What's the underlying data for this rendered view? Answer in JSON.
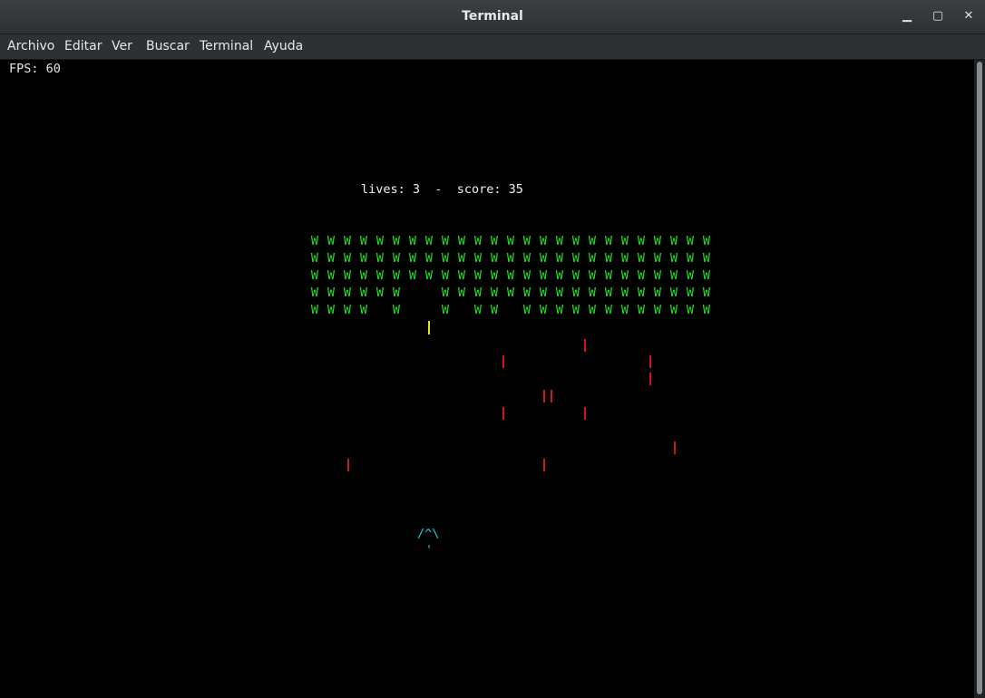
{
  "window": {
    "title": "Terminal",
    "minimize": "▁",
    "maximize": "▢",
    "close": "✕"
  },
  "menu": [
    "Archivo",
    "Editar",
    "Ver",
    "Buscar",
    "Terminal",
    "Ayuda"
  ],
  "game": {
    "fps_text": "FPS: 60",
    "lives_label": "lives:",
    "lives": "3",
    "separator": "-",
    "score_label": "score:",
    "score": "35",
    "alien_glyph": "W",
    "alien_rows": [
      "WWWWWWWWWWWWWWWWWWWWWWWWW",
      "WWWWWWWWWWWWWWWWWWWWWWWWW",
      "WWWWWWWWWWWWWWWWWWWWWWWWW",
      "WWWWWW  WWWWWWWWWWWWWWWWW",
      "WWWW W  W WW WWWWWWWWWWWW"
    ],
    "ship_top": "/^\\",
    "ship_bottom": "'",
    "colors": {
      "alien": "#22e01f",
      "enemy_bullet": "#d01616",
      "player_bullet": "#f0e011",
      "ship": "#26c5e0",
      "text": "#f0f0f0"
    }
  }
}
